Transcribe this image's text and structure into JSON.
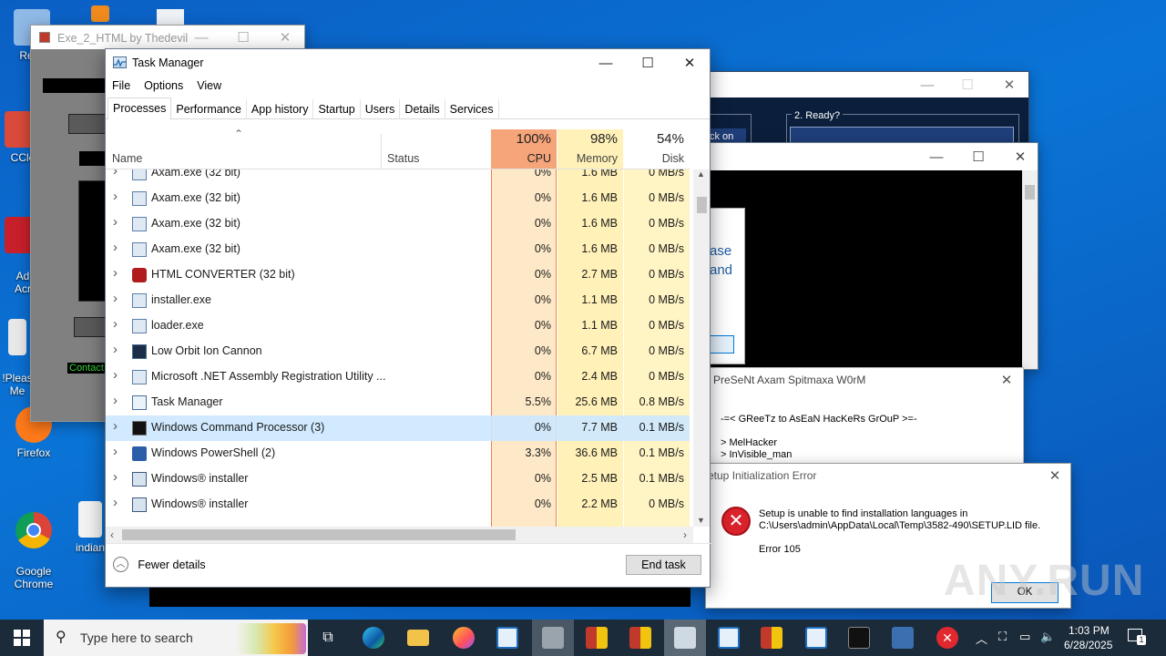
{
  "desktop": {
    "icons": [
      {
        "label": "Recy",
        "color": "#8fb9e6"
      },
      {
        "label": "CCle",
        "color": "#d94a3a"
      },
      {
        "label": "Ad\nAcr",
        "color": "#c8202a"
      },
      {
        "label": "!Pleas\nMe",
        "color": "#e8e8e8"
      },
      {
        "label": "Firefox",
        "color": "#ff7a1a"
      },
      {
        "label": "Google\nChrome",
        "color": "#2a9d4a"
      },
      {
        "label": "indian",
        "color": "#f2f2f2"
      }
    ]
  },
  "exe_window": {
    "title": "Exe_2_HTML by Thedevil",
    "contact_label": "Contact"
  },
  "cmd_window": {
    "section_label": "2. Ready?",
    "button_fragment": "ck on"
  },
  "partial_dialog": {
    "line1": "ase",
    "line2": "and"
  },
  "axam_window": {
    "title": "PreSeNt Axam Spitmaxa W0rM",
    "line1": "-=< GReeTz to AsEaN HacKeRs GrOuP >=-",
    "line2": "> MelHacker",
    "line3": "> InVisible_man"
  },
  "error_dialog": {
    "title": "etup Initialization Error",
    "message_line1": "Setup is unable to find installation languages in",
    "message_line2": "C:\\Users\\admin\\AppData\\Local\\Temp\\3582-490\\SETUP.LID file.",
    "error_code": "Error 105",
    "ok_label": "OK"
  },
  "watermark": "ANY.RUN",
  "task_manager": {
    "title": "Task Manager",
    "menu": [
      "File",
      "Options",
      "View"
    ],
    "tabs": [
      "Processes",
      "Performance",
      "App history",
      "Startup",
      "Users",
      "Details",
      "Services"
    ],
    "active_tab": "Processes",
    "columns": {
      "name": "Name",
      "status": "Status",
      "cpu_pct": "100%",
      "cpu": "CPU",
      "mem_pct": "98%",
      "mem": "Memory",
      "disk_pct": "54%",
      "disk": "Disk"
    },
    "rows": [
      {
        "name": "Axam.exe (32 bit)",
        "cpu": "0%",
        "mem": "1.6 MB",
        "disk": "0 MB/s",
        "icon": "app-icon"
      },
      {
        "name": "Axam.exe (32 bit)",
        "cpu": "0%",
        "mem": "1.6 MB",
        "disk": "0 MB/s",
        "icon": "app-icon"
      },
      {
        "name": "Axam.exe (32 bit)",
        "cpu": "0%",
        "mem": "1.6 MB",
        "disk": "0 MB/s",
        "icon": "app-icon"
      },
      {
        "name": "Axam.exe (32 bit)",
        "cpu": "0%",
        "mem": "1.6 MB",
        "disk": "0 MB/s",
        "icon": "app-icon"
      },
      {
        "name": "HTML CONVERTER (32 bit)",
        "cpu": "0%",
        "mem": "2.7 MB",
        "disk": "0 MB/s",
        "icon": "converter-icon"
      },
      {
        "name": "installer.exe",
        "cpu": "0%",
        "mem": "1.1 MB",
        "disk": "0 MB/s",
        "icon": "app-icon"
      },
      {
        "name": "loader.exe",
        "cpu": "0%",
        "mem": "1.1 MB",
        "disk": "0 MB/s",
        "icon": "app-icon"
      },
      {
        "name": "Low Orbit Ion Cannon",
        "cpu": "0%",
        "mem": "6.7 MB",
        "disk": "0 MB/s",
        "icon": "loic-icon"
      },
      {
        "name": "Microsoft .NET Assembly Registration Utility ...",
        "cpu": "0%",
        "mem": "2.4 MB",
        "disk": "0 MB/s",
        "icon": "app-icon"
      },
      {
        "name": "Task Manager",
        "cpu": "5.5%",
        "mem": "25.6 MB",
        "disk": "0.8 MB/s",
        "icon": "taskmgr-icon"
      },
      {
        "name": "Windows Command Processor (3)",
        "cpu": "0%",
        "mem": "7.7 MB",
        "disk": "0.1 MB/s",
        "icon": "cmd-icon",
        "selected": true
      },
      {
        "name": "Windows PowerShell (2)",
        "cpu": "3.3%",
        "mem": "36.6 MB",
        "disk": "0.1 MB/s",
        "icon": "powershell-icon"
      },
      {
        "name": "Windows® installer",
        "cpu": "0%",
        "mem": "2.5 MB",
        "disk": "0.1 MB/s",
        "icon": "msi-icon"
      },
      {
        "name": "Windows® installer",
        "cpu": "0%",
        "mem": "2.2 MB",
        "disk": "0 MB/s",
        "icon": "msi-icon"
      }
    ],
    "fewer_details": "Fewer details",
    "end_task": "End task"
  },
  "taskbar": {
    "search_placeholder": "Type here to search",
    "time": "1:03 PM",
    "date": "6/28/2025",
    "notification_count": "1"
  }
}
